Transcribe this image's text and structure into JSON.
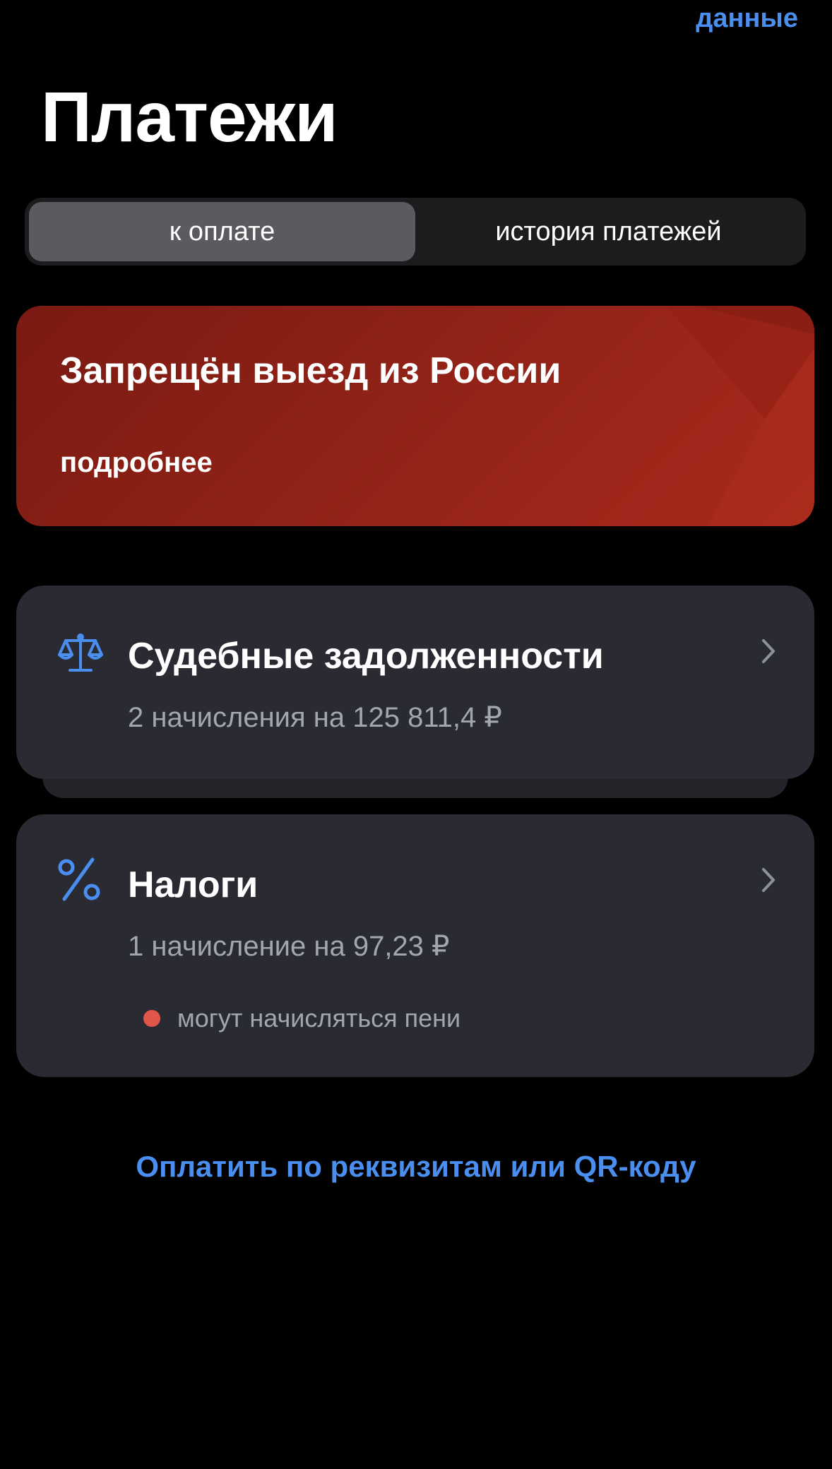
{
  "header": {
    "top_link": "данные",
    "title": "Платежи"
  },
  "tabs": [
    {
      "label": "к оплате",
      "active": true
    },
    {
      "label": "история платежей",
      "active": false
    }
  ],
  "alert": {
    "title": "Запрещён выезд из России",
    "more": "подробнее",
    "color": "#a82a1d"
  },
  "cards": [
    {
      "icon": "scales-icon",
      "title": "Судебные задолженности",
      "subtitle": "2 начисления на 125 811,4 ₽"
    },
    {
      "icon": "percent-icon",
      "title": "Налоги",
      "subtitle": "1 начисление на 97,23 ₽",
      "warning": "могут начисляться пени"
    }
  ],
  "footer": {
    "pay_link": "Оплатить по реквизитам или QR-коду"
  },
  "colors": {
    "accent": "#4a8ef0",
    "card_bg": "#2a2b32",
    "warning_dot": "#e2554a"
  }
}
